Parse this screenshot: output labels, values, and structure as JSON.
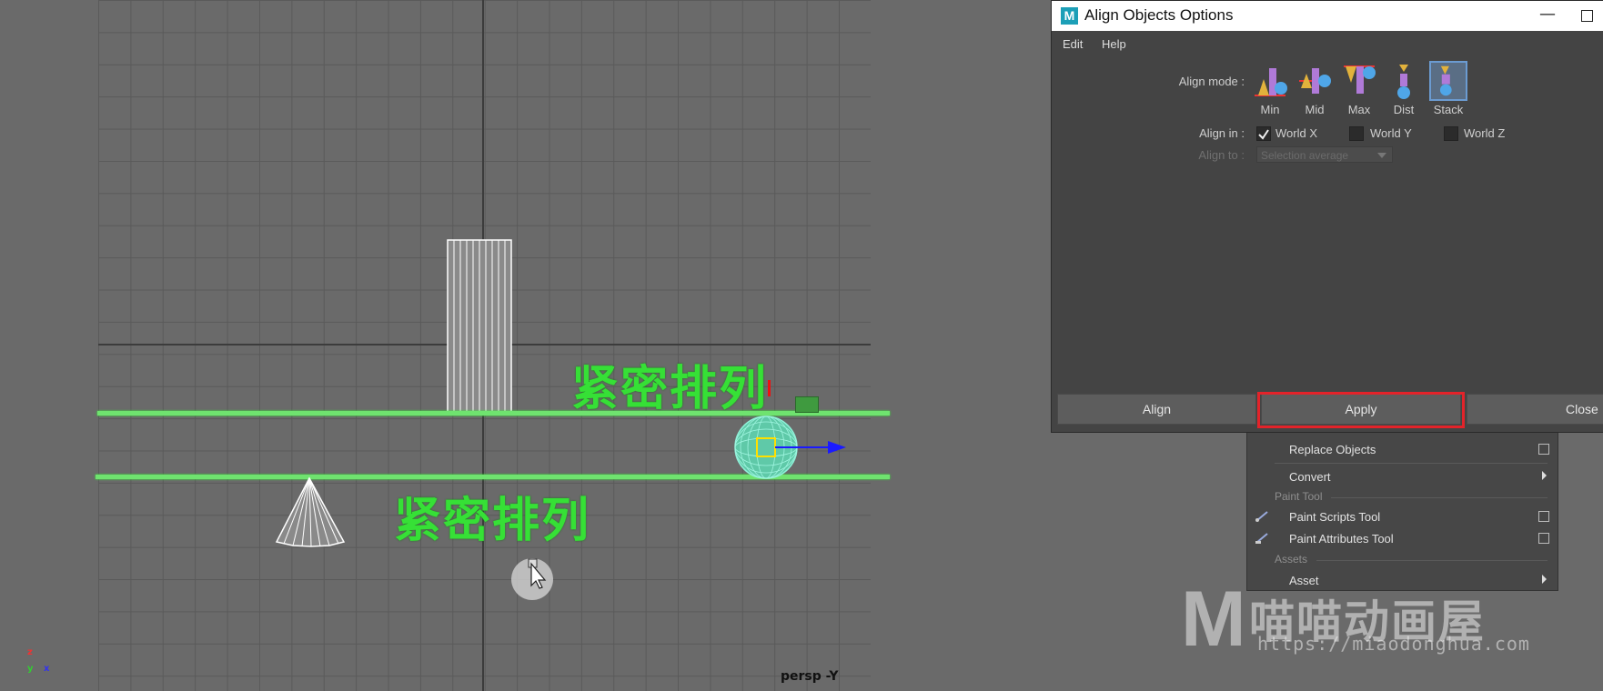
{
  "viewport": {
    "camera_label": "persp -Y",
    "annotations": [
      "紧密排列",
      "紧密排列"
    ],
    "guide_color": "#6fe36f",
    "axis": {
      "x": "x",
      "y": "y",
      "z": "z"
    }
  },
  "dialog": {
    "title": "Align Objects Options",
    "app_icon": "M",
    "menus": [
      "Edit",
      "Help"
    ],
    "align_mode_label": "Align mode :",
    "modes": [
      {
        "label": "Min",
        "icon": "align-min-icon",
        "selected": false
      },
      {
        "label": "Mid",
        "icon": "align-mid-icon",
        "selected": false
      },
      {
        "label": "Max",
        "icon": "align-max-icon",
        "selected": false
      },
      {
        "label": "Dist",
        "icon": "align-dist-icon",
        "selected": false
      },
      {
        "label": "Stack",
        "icon": "align-stack-icon",
        "selected": true
      }
    ],
    "align_in_label": "Align in :",
    "align_in": [
      {
        "label": "World X",
        "checked": true
      },
      {
        "label": "World Y",
        "checked": false
      },
      {
        "label": "World Z",
        "checked": false
      }
    ],
    "align_to_label": "Align to :",
    "align_to_value": "Selection average",
    "buttons": {
      "align": "Align",
      "apply": "Apply",
      "close": "Close"
    },
    "highlight_color": "#e3232a"
  },
  "context_menu": {
    "replace_objects": "Replace Objects",
    "convert": "Convert",
    "paint_tool_header": "Paint Tool",
    "paint_scripts_tool": "Paint Scripts Tool",
    "paint_attributes_tool": "Paint Attributes Tool",
    "assets_header": "Assets",
    "asset": "Asset"
  },
  "watermark": {
    "logo": "M",
    "name": "喵喵动画屋",
    "url": "https://miaodonghua.com"
  }
}
